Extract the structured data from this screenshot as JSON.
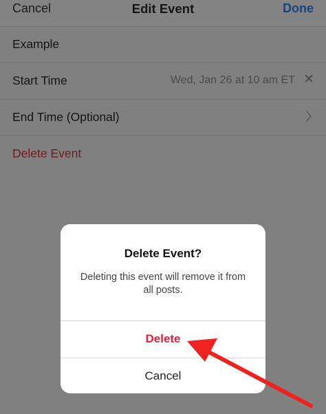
{
  "nav": {
    "cancel_label": "Cancel",
    "title": "Edit Event",
    "done_label": "Done"
  },
  "form": {
    "name_value": "Example",
    "start_time_label": "Start Time",
    "start_time_value": "Wed, Jan 26 at 10 am ET",
    "clear_icon": "✕",
    "end_time_label": "End Time (Optional)",
    "delete_event_label": "Delete Event"
  },
  "alert": {
    "title": "Delete Event?",
    "message": "Deleting this event will remove it from all posts.",
    "delete_label": "Delete",
    "cancel_label": "Cancel"
  },
  "colors": {
    "accent": "#0a7aff",
    "destructive": "#e4203a",
    "annotation_arrow": "#f0211e"
  }
}
